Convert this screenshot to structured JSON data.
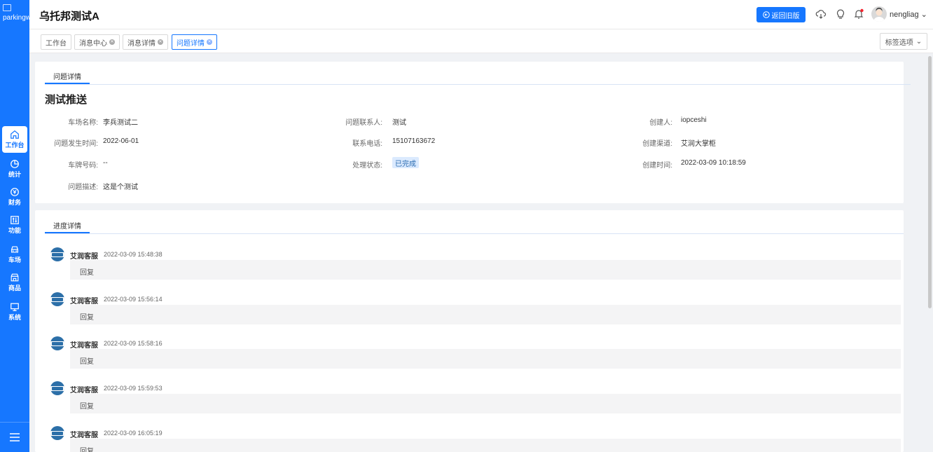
{
  "app": {
    "logo_alt": "parkingwang",
    "title": "乌托邦测试A"
  },
  "sidebar": {
    "items": [
      {
        "label": "工作台",
        "icon": "home-icon",
        "active": true
      },
      {
        "label": "统计",
        "icon": "pie-chart-icon"
      },
      {
        "label": "财务",
        "icon": "yen-circle-icon"
      },
      {
        "label": "功能",
        "icon": "sliders-icon"
      },
      {
        "label": "车场",
        "icon": "car-icon"
      },
      {
        "label": "商品",
        "icon": "shop-icon"
      },
      {
        "label": "系统",
        "icon": "monitor-icon"
      }
    ],
    "menu_icon": "menu-icon"
  },
  "header": {
    "old_version_label": "返回旧版",
    "username": "nengliag"
  },
  "tabs": {
    "items": [
      "工作台",
      "消息中心",
      "消息详情",
      "问题详情"
    ],
    "options_label": "标签选项"
  },
  "detail": {
    "tab_label": "问题详情",
    "title": "测试推送",
    "fields": {
      "park_name_label": "车场名称:",
      "park_name": "李兵测试二",
      "contact_label": "问题联系人:",
      "contact": "测试",
      "creator_label": "创建人:",
      "creator": "iopceshi",
      "occur_time_label": "问题发生时间:",
      "occur_time": "2022-06-01",
      "phone_label": "联系电话:",
      "phone": "15107163672",
      "channel_label": "创建渠道:",
      "channel": "艾润大掌柜",
      "plate_label": "车牌号码:",
      "plate": "--",
      "status_label": "处理状态:",
      "status": "已完成",
      "created_label": "创建时间:",
      "created": "2022-03-09 10:18:59",
      "desc_label": "问题描述:",
      "desc": "这是个测试"
    }
  },
  "progress": {
    "tab_label": "进度详情",
    "entries": [
      {
        "name": "艾润客服",
        "time": "2022-03-09 15:48:38",
        "reply": "回复"
      },
      {
        "name": "艾润客服",
        "time": "2022-03-09 15:56:14",
        "reply": "回复"
      },
      {
        "name": "艾润客服",
        "time": "2022-03-09 15:58:16",
        "reply": "回复"
      },
      {
        "name": "艾润客服",
        "time": "2022-03-09 15:59:53",
        "reply": "回复"
      },
      {
        "name": "艾润客服",
        "time": "2022-03-09 16:05:19",
        "reply": "回复"
      }
    ]
  },
  "colors": {
    "primary": "#1677ff",
    "status_bg": "#dbeafe"
  }
}
